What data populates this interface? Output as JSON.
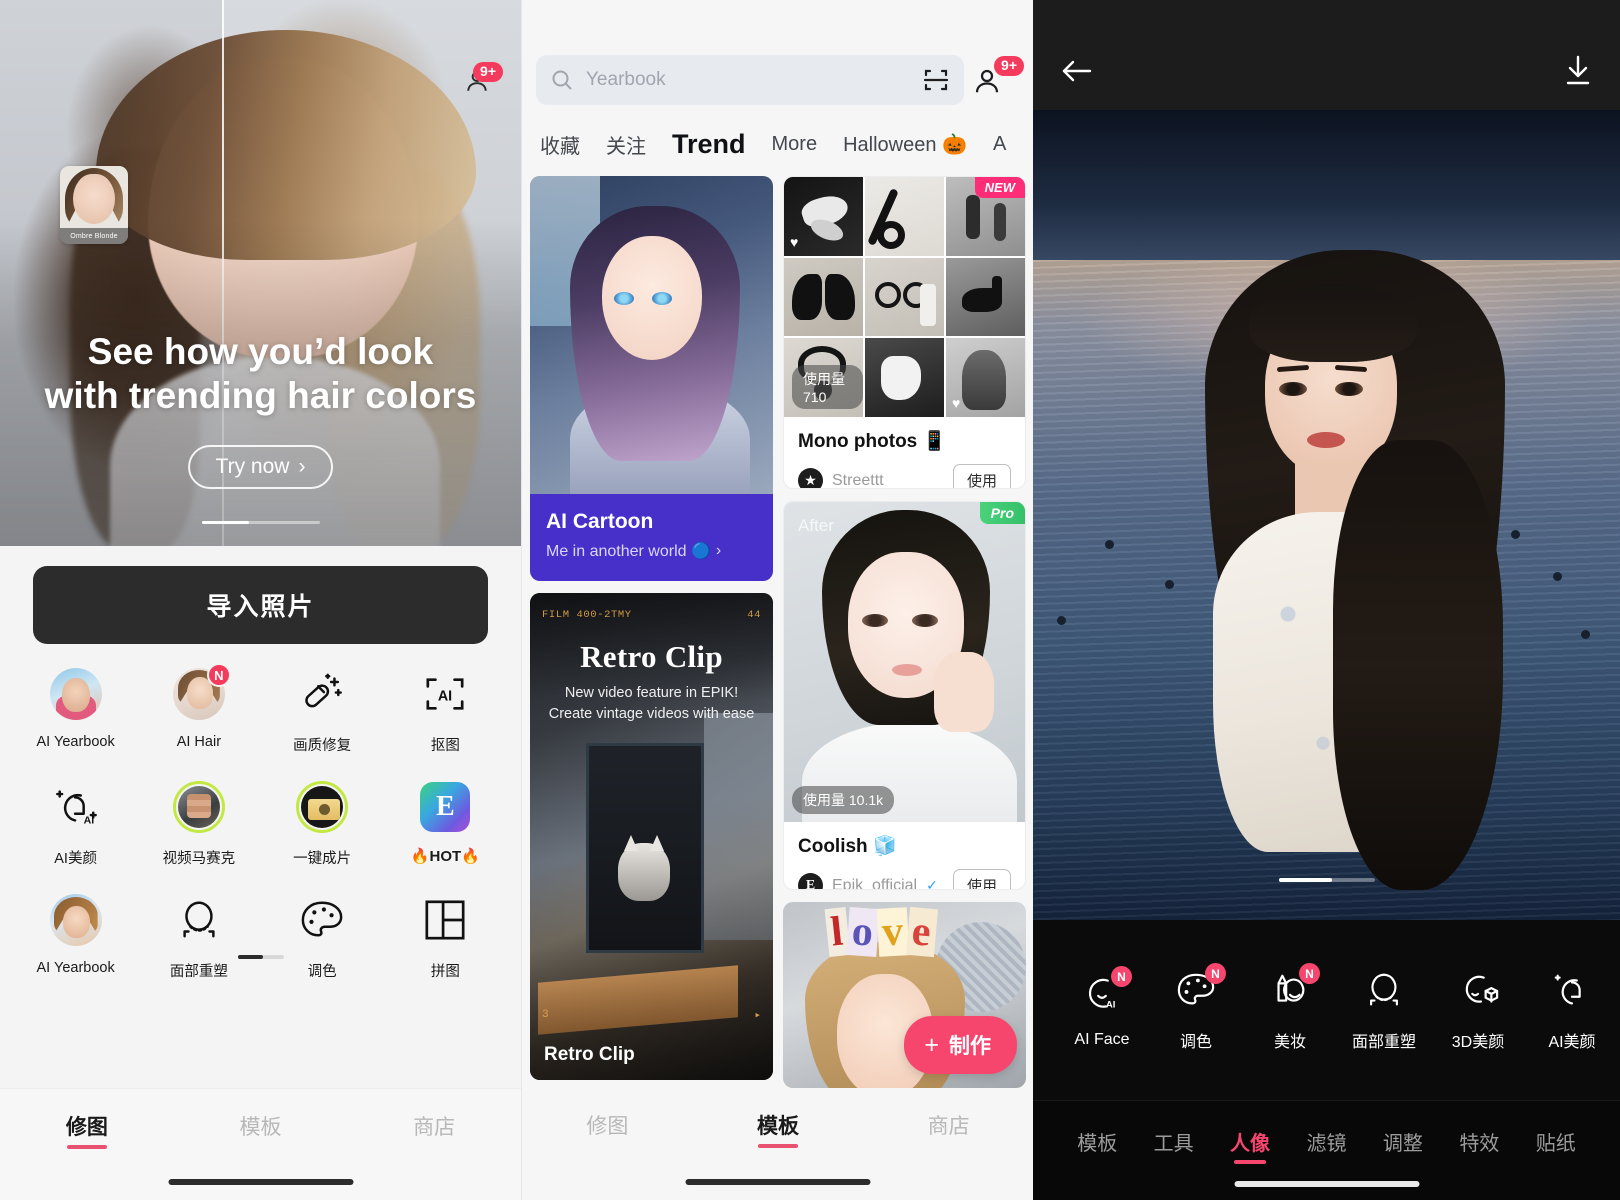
{
  "panel_editor": {
    "hero": {
      "title_line1": "See how you’d look",
      "title_line2": "with trending hair colors",
      "cta_label": "Try now",
      "cta_chevron": "›",
      "thumb_caption": "Ombre Blonde",
      "notification_badge": "9+"
    },
    "import_button": "导入照片",
    "tools": [
      {
        "label": "AI Yearbook",
        "icon": "avatar-photo-icon",
        "badge": ""
      },
      {
        "label": "AI Hair",
        "icon": "avatar-photo-icon",
        "badge": "N"
      },
      {
        "label": "画质修复",
        "icon": "magic-wand-icon",
        "badge": ""
      },
      {
        "label": "抠图",
        "icon": "ai-cutout-icon",
        "badge": ""
      },
      {
        "label": "AI美颜",
        "icon": "ai-beauty-face-icon",
        "badge": ""
      },
      {
        "label": "视频马赛克",
        "icon": "video-mosaic-icon",
        "badge": ""
      },
      {
        "label": "一键成片",
        "icon": "camera-auto-icon",
        "badge": ""
      },
      {
        "label": "🔥HOT🔥",
        "icon": "epik-app-icon",
        "badge": ""
      },
      {
        "label": "AI Yearbook",
        "icon": "avatar-photo-icon",
        "badge": ""
      },
      {
        "label": "面部重塑",
        "icon": "face-reshape-icon",
        "badge": ""
      },
      {
        "label": "调色",
        "icon": "palette-icon",
        "badge": ""
      },
      {
        "label": "拼图",
        "icon": "collage-icon",
        "badge": ""
      }
    ],
    "bottom_tabs": [
      {
        "label": "修图",
        "active": true
      },
      {
        "label": "模板",
        "active": false
      },
      {
        "label": "商店",
        "active": false
      }
    ]
  },
  "panel_templates": {
    "search": {
      "value": "Yearbook",
      "placeholder": "Yearbook",
      "icon": "search-icon",
      "scan_icon": "scan-code-icon"
    },
    "profile": {
      "icon": "person-icon",
      "badge": "9+"
    },
    "tabs": [
      {
        "label": "收藏",
        "active": false
      },
      {
        "label": "关注",
        "active": false
      },
      {
        "label": "Trend",
        "active": true
      },
      {
        "label": "More",
        "active": false
      },
      {
        "label": "Halloween 🎃",
        "active": false
      },
      {
        "label": "A",
        "active": false
      }
    ],
    "cards": {
      "ai_cartoon": {
        "title": "AI Cartoon",
        "subtitle": "Me in another world 🔵",
        "chevron": "›"
      },
      "retro_clip": {
        "film_left": "FILM 400-2TMY",
        "film_right": "44",
        "title": "Retro Clip",
        "sub_line1": "New video feature in EPIK!",
        "sub_line2": "Create vintage videos with ease",
        "mark_left": "3",
        "name": "Retro Clip"
      },
      "mono_photos": {
        "badge": "NEW",
        "usage": "使用量 710",
        "title": "Mono photos 📱",
        "author": "Streettt",
        "use_label": "使用"
      },
      "coolish": {
        "badge": "Pro",
        "after_label": "After",
        "usage": "使用量 10.1k",
        "title": "Coolish 🧊",
        "author": "Epik_official",
        "verified": "✓",
        "use_label": "使用"
      },
      "love_card": {
        "word": "love"
      }
    },
    "make_button": {
      "plus": "+",
      "label": "制作"
    },
    "bottom_tabs": [
      {
        "label": "修图",
        "active": false
      },
      {
        "label": "模板",
        "active": true
      },
      {
        "label": "商店",
        "active": false
      }
    ]
  },
  "panel_photo_editor": {
    "header": {
      "back_icon": "arrow-left-icon",
      "download_icon": "download-icon"
    },
    "tools": [
      {
        "label": "AI Face",
        "icon": "ai-face-icon",
        "badge": "N"
      },
      {
        "label": "调色",
        "icon": "palette-icon",
        "badge": "N"
      },
      {
        "label": "美妆",
        "icon": "makeup-icon",
        "badge": "N"
      },
      {
        "label": "面部重塑",
        "icon": "face-reshape-icon",
        "badge": ""
      },
      {
        "label": "3D美颜",
        "icon": "3d-beauty-icon",
        "badge": ""
      },
      {
        "label": "AI美颜",
        "icon": "ai-beauty-face-icon",
        "badge": ""
      }
    ],
    "tabs": [
      {
        "label": "模板",
        "active": false
      },
      {
        "label": "工具",
        "active": false
      },
      {
        "label": "人像",
        "active": true
      },
      {
        "label": "滤镜",
        "active": false
      },
      {
        "label": "调整",
        "active": false
      },
      {
        "label": "特效",
        "active": false
      },
      {
        "label": "贴纸",
        "active": false
      }
    ]
  },
  "colors": {
    "accent_pink": "#f6466e",
    "tab_underline": "#e8516f",
    "purple_card": "#4630c9",
    "ring_green": "#c3e843",
    "badge_new": "#ff2d78",
    "badge_pro": "#3cc96f"
  }
}
